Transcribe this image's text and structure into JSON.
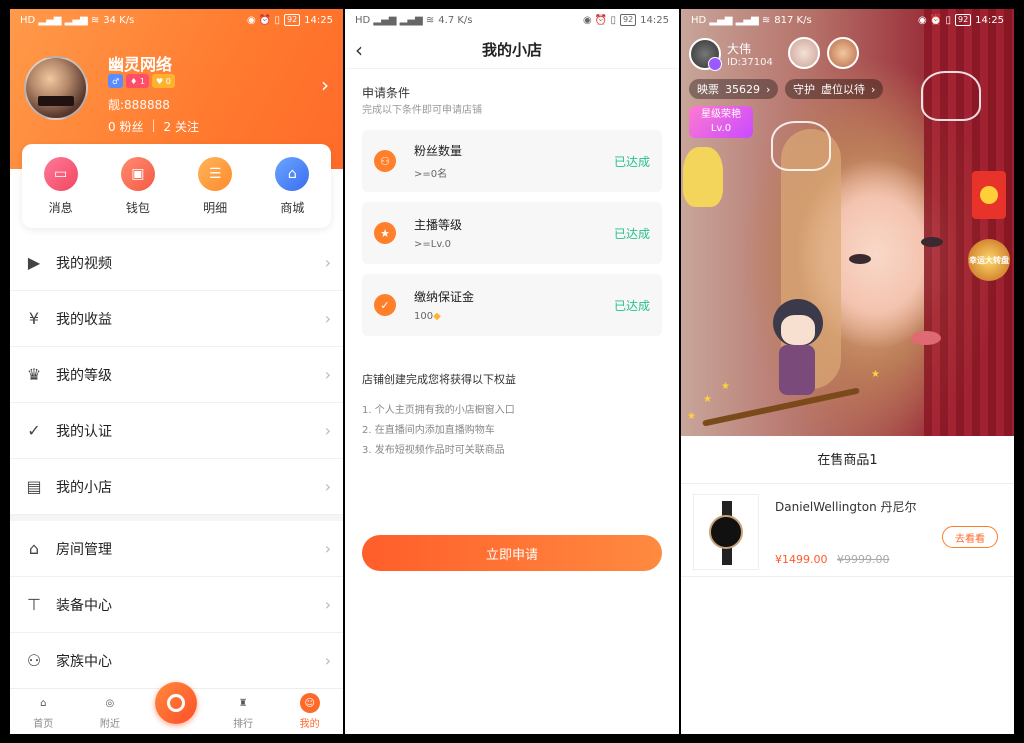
{
  "status": {
    "time": "14:25",
    "battery": "92",
    "net1": "34 K/s",
    "net2": "4.7 K/s",
    "net3": "817 K/s"
  },
  "profile": {
    "username": "幽灵网络",
    "badge_gender": "♂",
    "badge_level": "1",
    "badge_vip": "0",
    "liang": "靓:888888",
    "fans": "0 粉丝",
    "following": "2 关注",
    "quick": [
      "消息",
      "钱包",
      "明细",
      "商城"
    ],
    "menu": [
      "我的视频",
      "我的收益",
      "我的等级",
      "我的认证",
      "我的小店",
      "房间管理",
      "装备中心",
      "家族中心"
    ],
    "tabs": [
      "首页",
      "附近",
      "排行",
      "我的"
    ]
  },
  "shop": {
    "title": "我的小店",
    "cond_title": "申请条件",
    "cond_sub": "完成以下条件即可申请店铺",
    "conditions": [
      {
        "name": "粉丝数量",
        "req": ">=0名",
        "status": "已达成"
      },
      {
        "name": "主播等级",
        "req": ">=Lv.0",
        "status": "已达成"
      },
      {
        "name": "缴纳保证金",
        "req": "100",
        "status": "已达成"
      }
    ],
    "benefit_title": "店铺创建完成您将获得以下权益",
    "benefits": [
      "1. 个人主页拥有我的小店橱窗入口",
      "2. 在直播间内添加直播购物车",
      "3. 发布短视频作品时可关联商品"
    ],
    "apply": "立即申请"
  },
  "live": {
    "host_name": "大伟",
    "host_id": "ID:37104",
    "votes_label": "映票",
    "votes": "35629",
    "guard_label": "守护",
    "guard_value": "虚位以待",
    "level_title": "星级荣艳",
    "level": "Lv.0",
    "wheel": "幸运大转盘",
    "goods_title": "在售商品1",
    "product": {
      "name": "DanielWellington 丹尼尔",
      "price": "¥1499.00",
      "old_price": "¥9999.00",
      "button": "去看看"
    }
  }
}
